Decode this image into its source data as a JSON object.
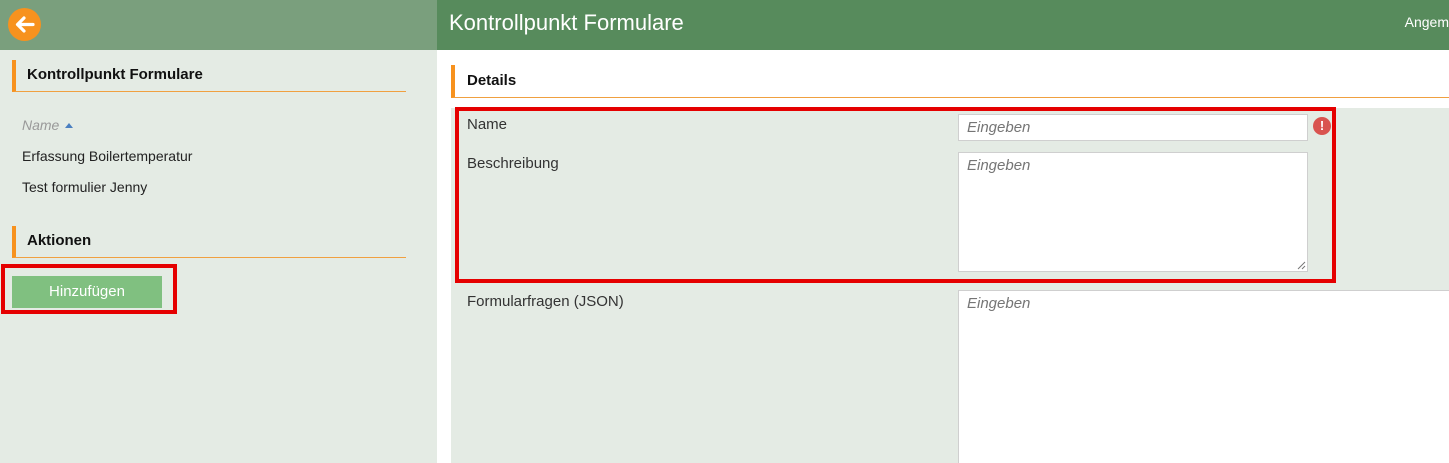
{
  "header": {
    "title": "Kontrollpunkt Formulare",
    "user_label": "Angem",
    "back_icon": "arrow-left-icon"
  },
  "sidebar": {
    "section_title": "Kontrollpunkt Formulare",
    "list_header": "Name",
    "items": [
      {
        "label": "Erfassung Boilertemperatur"
      },
      {
        "label": "Test formulier Jenny"
      }
    ],
    "actions_title": "Aktionen",
    "add_button": "Hinzufügen"
  },
  "details": {
    "title": "Details",
    "fields": {
      "name": {
        "label": "Name",
        "placeholder": "Eingeben"
      },
      "description": {
        "label": "Beschreibung",
        "placeholder": "Eingeben"
      },
      "questions": {
        "label": "Formularfragen (JSON)",
        "placeholder": "Eingeben"
      }
    },
    "error_icon": "!"
  },
  "colors": {
    "topbar": "#578b5c",
    "sidebar_header": "#7a9f7d",
    "accent": "#f7921e",
    "button": "#80c080",
    "highlight": "#e50000"
  }
}
